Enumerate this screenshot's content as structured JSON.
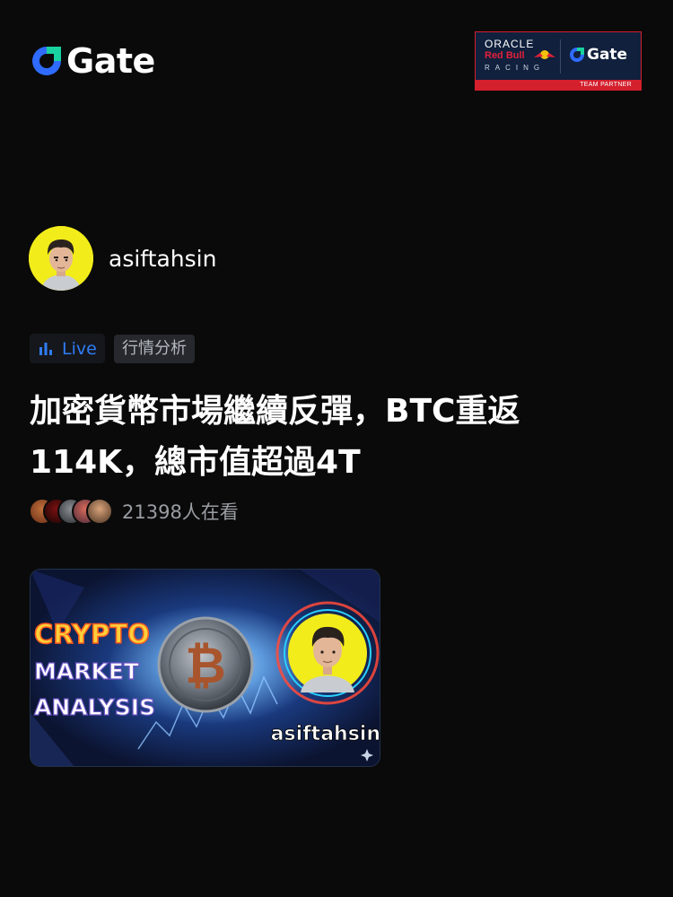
{
  "header": {
    "logo_text": "Gate",
    "partner": {
      "oracle": "ORACLE",
      "redbull": "Red Bull",
      "racing": "RACING",
      "logo_text": "Gate",
      "band": "TEAM PARTNER"
    }
  },
  "author": {
    "name": "asiftahsin",
    "avatar_icon": "cartoon-avatar"
  },
  "tags": {
    "live": "Live",
    "category": "行情分析"
  },
  "post": {
    "title_line1": "加密貨幣市場繼續反彈，BTC重返",
    "title_line2": "114K，總市值超過4T"
  },
  "viewers": {
    "count_text": "21398人在看"
  },
  "thumbnail": {
    "line1": "CRYPTO",
    "line2": "MARKET",
    "line3": "ANALYSIS",
    "handle": "asiftahsin"
  },
  "colors": {
    "background": "#0a0a0a",
    "accent_blue": "#2f7cf6",
    "brand_red": "#d41f2d"
  }
}
